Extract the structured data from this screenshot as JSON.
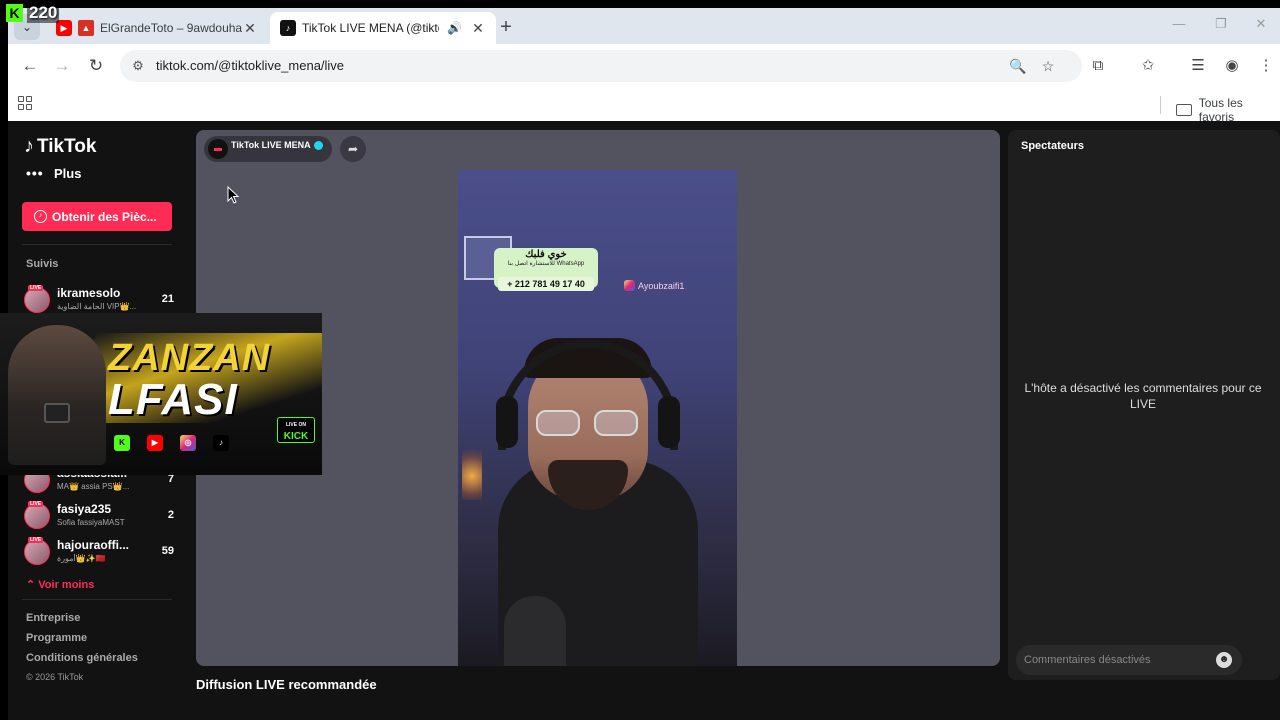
{
  "overlay": {
    "kick_label": "K",
    "viewer_count": "220"
  },
  "browser": {
    "tabs": [
      {
        "title": "ElGrandeToto – 9awdouha (",
        "active": false
      },
      {
        "title": "TikTok LIVE MENA (@tiktok",
        "active": true
      }
    ],
    "new_tab": "+",
    "url": "tiktok.com/@tiktoklive_mena/live",
    "bookmarks_all": "Tous les favoris"
  },
  "sidebar": {
    "logo": "TikTok",
    "more": "Plus",
    "coins_button": "Obtenir des Pièc...",
    "section_label": "Suivis",
    "following": [
      {
        "name": "ikramesolo",
        "sub": "الحامة الضاوية VIP👑...",
        "count": "21"
      },
      {
        "name": "assiaassia...",
        "sub": "MA👑 assia PS👑...",
        "count": "7"
      },
      {
        "name": "fasiya235",
        "sub": "Sofia fassiyaMAST",
        "count": "2"
      },
      {
        "name": "hajouraoffi...",
        "sub": "أمورة👑✨🇲🇦",
        "count": "59"
      }
    ],
    "see_less": "Voir moins",
    "footer_links": [
      "Entreprise",
      "Programme",
      "Conditions générales"
    ],
    "copyright": "© 2026 TikTok"
  },
  "banner": {
    "line1": "ZANZAN",
    "line2": "LFASI",
    "live_on": "LIVE ON",
    "kick": "KICK"
  },
  "live": {
    "host_name": "TikTok LIVE MENA",
    "sticker_arabic": "خوي فلبك",
    "sticker_small": "للاستشارة اتصل بنا WhatsApp",
    "sticker_phone": "+ 212 781 49 17 40",
    "instagram_handle": "Ayoubzaifi1",
    "below_text": "Diffusion LIVE recommandée"
  },
  "right_panel": {
    "title": "Spectateurs",
    "message": "L'hôte a désactivé les commentaires pour ce LIVE",
    "comment_placeholder": "Commentaires désactivés"
  },
  "colors": {
    "accent": "#fe2c55",
    "kick_green": "#53fc18",
    "live_bg": "#53525f"
  }
}
